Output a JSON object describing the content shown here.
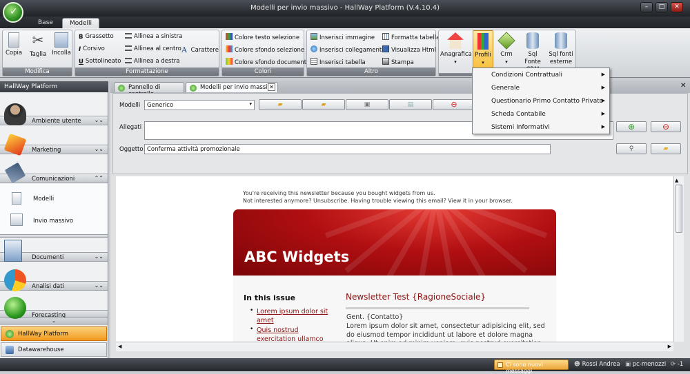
{
  "window": {
    "title": "Modelli per invio massivo - HallWay Platform (V.4.10.4)"
  },
  "ribbon_tabs": [
    "Base",
    "Modelli"
  ],
  "ribbon": {
    "modifica": {
      "caption": "Modifica",
      "buttons": [
        "Copia",
        "Taglia",
        "Incolla"
      ]
    },
    "formattazione": {
      "caption": "Formattazione",
      "items": [
        "Grassetto",
        "Corsivo",
        "Sottolineato",
        "Allinea a sinistra",
        "Allinea al centro",
        "Allinea a destra",
        "Carattere"
      ]
    },
    "colori": {
      "caption": "Colori",
      "items": [
        "Colore testo selezione",
        "Colore sfondo selezione",
        "Colore sfondo documento"
      ]
    },
    "altro": {
      "caption": "Altro",
      "items": [
        "Inserisci immagine",
        "Inserisci collegamento",
        "Inserisci tabella",
        "Formatta tabella",
        "Visualizza Html",
        "Stampa"
      ]
    },
    "apps": {
      "buttons": [
        "Anagrafica",
        "Profili",
        "Crm",
        "Sql Fonte CRM",
        "Sql fonti esterne"
      ]
    }
  },
  "profili_menu": [
    "Condizioni Contrattuali",
    "Generale",
    "Questionario Primo Contatto Privato",
    "Scheda Contabile",
    "Sistemi Informativi"
  ],
  "sidebar": {
    "header": "HallWay Platform",
    "sections": [
      "Ambiente utente",
      "Marketing",
      "Comunicazioni",
      "Documenti",
      "Analisi dati",
      "Forecasting"
    ],
    "comunicazioni_items": [
      "Modelli",
      "Invio massivo"
    ],
    "bottom_items": [
      "HallWay Platform",
      "Datawarehouse"
    ]
  },
  "doc_tabs": [
    "Pannello di controllo",
    "Modelli per invio massivo"
  ],
  "form": {
    "modelli_label": "Modelli",
    "modelli_value": "Generico",
    "allegati_label": "Allegati",
    "oggetto_label": "Oggetto",
    "oggetto_value": "Conferma attività promozionale"
  },
  "email": {
    "preheader_1": "You're receiving this newsletter because you bought widgets from us.",
    "preheader_2": "Not interested anymore? Unsubscribe. Having trouble viewing this email? View it in your browser.",
    "banner_title": "ABC Widgets",
    "sidebar_title": "In this issue",
    "links": [
      "Lorem ipsum dolor sit amet",
      "Quis nostrud exercitation ullamco"
    ],
    "headline": "Newsletter Test {RagioneSociale}",
    "greeting": "Gent. {Contatto}",
    "body": "Lorem ipsum dolor sit amet, consectetur adipisicing elit, sed do eiusmod tempor incididunt ut labore et dolore magna aliqua. Ut enim ad minim veniam, quis nostrud exercitation ullamco"
  },
  "statusbar": {
    "messages": "Ci sono nuovi messaggi",
    "user": "Rossi Andrea",
    "machine": "pc-menozzi",
    "count": "-1"
  },
  "colors": {
    "accent_red": "#b10f12",
    "sidebar_active": "#f6a53a",
    "link": "#8b1010"
  }
}
